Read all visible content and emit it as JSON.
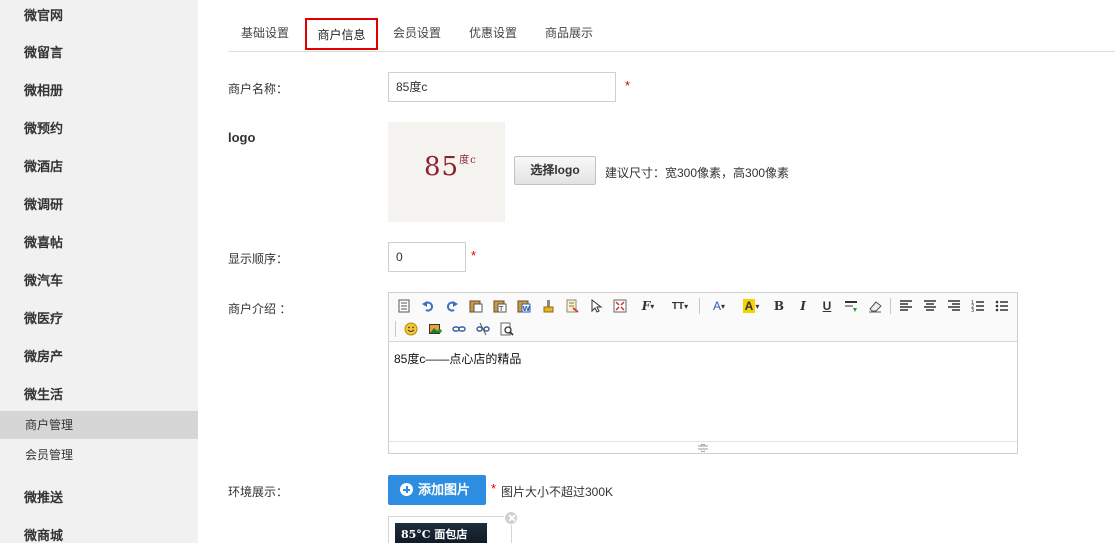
{
  "sidebar": {
    "items": [
      {
        "label": "微官网"
      },
      {
        "label": "微留言"
      },
      {
        "label": "微相册"
      },
      {
        "label": "微预约"
      },
      {
        "label": "微酒店"
      },
      {
        "label": "微调研"
      },
      {
        "label": "微喜帖"
      },
      {
        "label": "微汽车"
      },
      {
        "label": "微医疗"
      },
      {
        "label": "微房产"
      },
      {
        "label": "微生活"
      }
    ],
    "sub_items": [
      {
        "label": "商户管理"
      },
      {
        "label": "会员管理"
      }
    ],
    "bottom_items": [
      {
        "label": "微推送"
      },
      {
        "label": "微商城"
      }
    ]
  },
  "tabs": [
    {
      "label": "基础设置"
    },
    {
      "label": "商户信息"
    },
    {
      "label": "会员设置"
    },
    {
      "label": "优惠设置"
    },
    {
      "label": "商品展示"
    }
  ],
  "form": {
    "name_label": "商户名称：",
    "name_value": "85度c",
    "required_mark": "*",
    "logo_label": "logo",
    "logo_text": "85",
    "logo_sup": "度c",
    "select_logo_button": "选择logo",
    "logo_hint": "建议尺寸：宽300像素，高300像素",
    "order_label": "显示顺序：",
    "order_value": "0",
    "intro_label": "商户介绍 ：",
    "intro_content": "85度c——点心店的精品",
    "env_label": "环境展示：",
    "add_image_button": "添加图片",
    "image_hint": "图片大小不超过300K",
    "thumb_text": "85°C 面包店"
  },
  "editor": {
    "toolbar_icons": [
      "source-icon",
      "undo-icon",
      "redo-icon",
      "paste-icon",
      "paste-text-icon",
      "paste-word-icon",
      "format-brush-icon",
      "clear-format-icon",
      "select-all-icon",
      "fullscreen-icon",
      "font-family-icon",
      "font-size-icon",
      "font-color-icon",
      "highlight-icon",
      "bold-icon",
      "italic-icon",
      "underline-icon",
      "line-height-icon",
      "eraser-icon",
      "align-left-icon",
      "align-center-icon",
      "align-right-icon",
      "ordered-list-icon",
      "unordered-list-icon",
      "emoticon-icon",
      "image-icon",
      "link-icon",
      "unlink-icon",
      "preview-icon"
    ],
    "glyphs": {
      "font": "F",
      "size": "TT",
      "color": "A",
      "bold": "B",
      "italic": "I",
      "underline": "U"
    }
  },
  "colors": {
    "accent_blue": "#2d8de0",
    "active_tab_border": "#e00000",
    "required": "#e00000",
    "logo_brand": "#8f2230"
  }
}
